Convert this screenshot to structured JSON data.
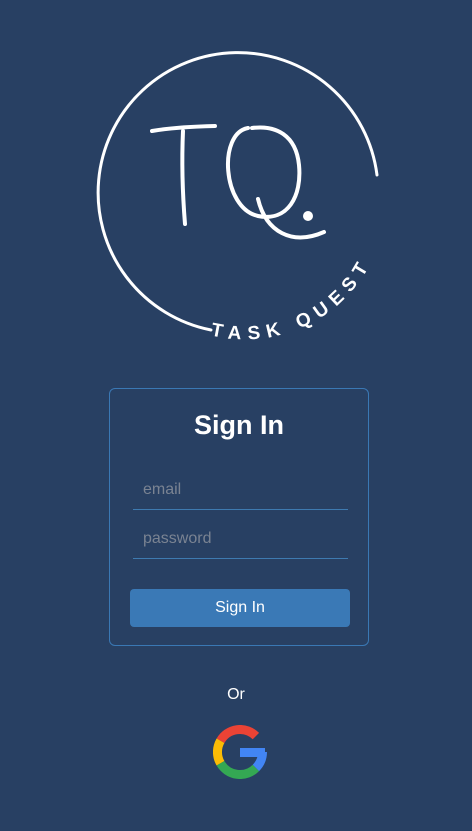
{
  "logo": {
    "monogram": "TQ",
    "brand_text": "TASK QUEST"
  },
  "signin": {
    "title": "Sign In",
    "email_placeholder": "email",
    "password_placeholder": "password",
    "submit_label": "Sign In"
  },
  "alt_login": {
    "or_label": "Or",
    "google_icon": "google-icon"
  },
  "colors": {
    "background": "#284063",
    "card_border": "#3a78b4",
    "button": "#3a79b6",
    "google_red": "#EA4335",
    "google_yellow": "#FBBC05",
    "google_green": "#34A853",
    "google_blue": "#4285F4"
  }
}
